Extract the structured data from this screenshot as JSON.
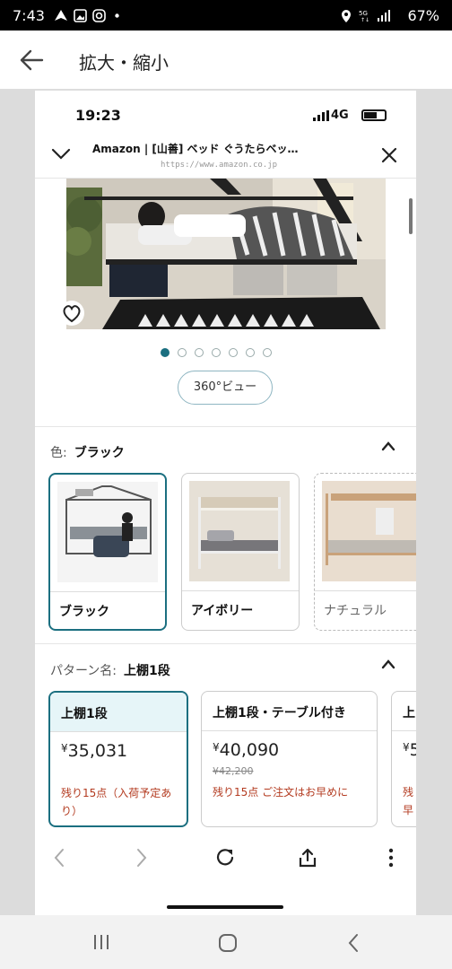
{
  "status_bar": {
    "time": "7:43",
    "battery": "67%"
  },
  "app_bar": {
    "title": "拡大・縮小"
  },
  "inner": {
    "time": "19:23",
    "network": "4G",
    "page_title": "Amazon | [山善] ベッド ぐうたらベッ…",
    "url": "https://www.amazon.co.jp",
    "carousel_count": 7,
    "carousel_active": 1,
    "view360_label": "360°ビュー",
    "color_section": {
      "label": "色:",
      "value": "ブラック"
    },
    "colors": [
      "ブラック",
      "アイボリー",
      "ナチュラル"
    ],
    "pattern_section": {
      "label": "パターン名:",
      "value": "上棚1段"
    },
    "patterns": [
      {
        "name": "上棚1段",
        "price": "35,031",
        "orig": "",
        "stock": "残り15点（入荷予定あり）"
      },
      {
        "name": "上棚1段・テーブル付き",
        "price": "40,090",
        "orig": "¥42,200",
        "stock": "残り15点 ご注文はお早めに"
      },
      {
        "name": "上",
        "price": "5",
        "orig": "",
        "stock": "残早"
      }
    ],
    "currency": "¥"
  },
  "colors": {
    "accent": "#1b6f80",
    "stock_text": "#b33a1f"
  }
}
